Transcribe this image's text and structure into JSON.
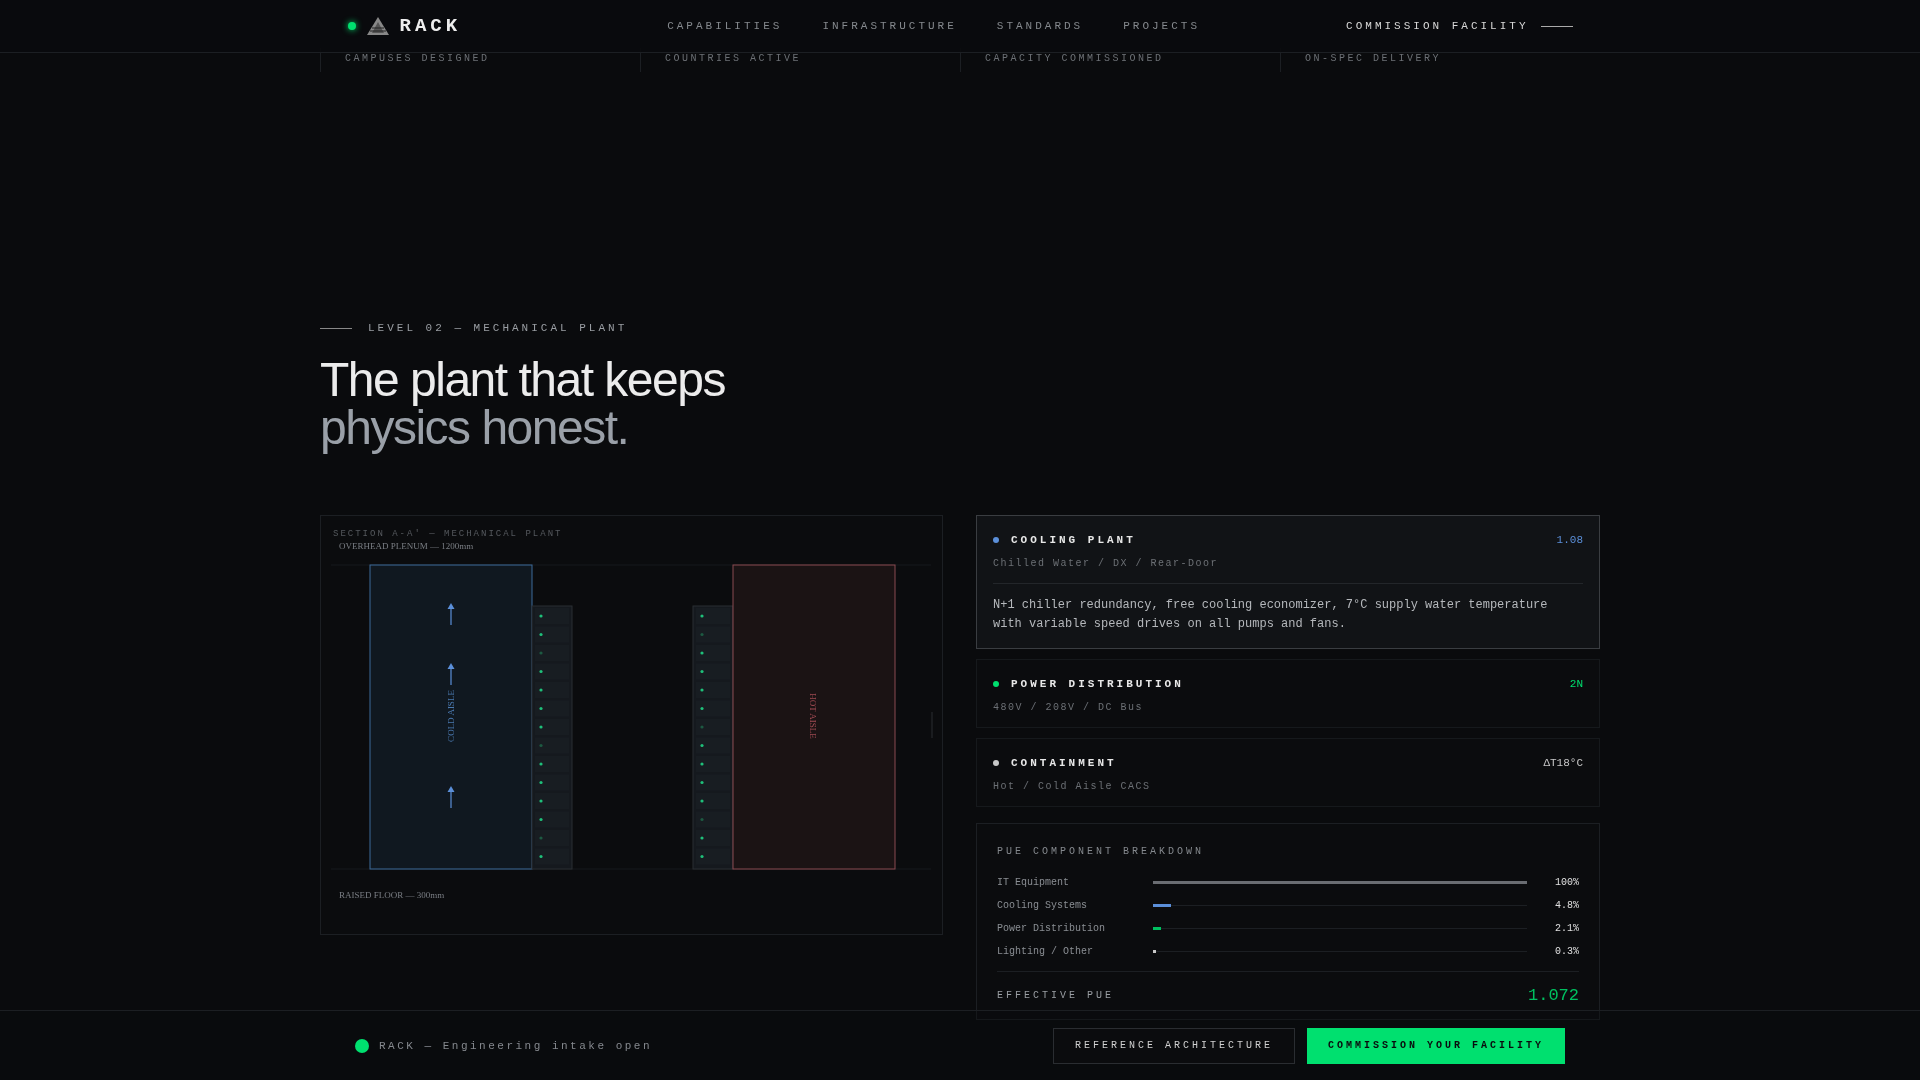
{
  "header": {
    "brand": "RACK",
    "nav": [
      {
        "label": "CAPABILITIES"
      },
      {
        "label": "INFRASTRUCTURE"
      },
      {
        "label": "STANDARDS"
      },
      {
        "label": "PROJECTS"
      }
    ],
    "cta": "COMMISSION FACILITY"
  },
  "stats": [
    {
      "label": "CAMPUSES DESIGNED"
    },
    {
      "label": "COUNTRIES ACTIVE"
    },
    {
      "label": "CAPACITY COMMISSIONED"
    },
    {
      "label": "ON-SPEC DELIVERY"
    }
  ],
  "section": {
    "eyebrow": "LEVEL 02 — MECHANICAL PLANT",
    "title": "The plant that keeps",
    "title_muted": "physics honest."
  },
  "diagram": {
    "title": "SECTION A-A′ — MECHANICAL PLANT",
    "top_label": "OVERHEAD PLENUM — 1200mm",
    "cold_label": "COLD AISLE",
    "hot_label": "HOT AISLE",
    "floor_label": "RAISED FLOOR — 300mm"
  },
  "systems": [
    {
      "name": "COOLING PLANT",
      "value": "1.08",
      "color": "#5b8fd9",
      "subtitle": "Chilled Water / DX / Rear-Door",
      "selected": true,
      "description": "N+1 chiller redundancy, free cooling economizer, 7°C supply water temperature with variable speed drives on all pumps and fans."
    },
    {
      "name": "POWER DISTRIBUTION",
      "value": "2N",
      "color": "#00e06f",
      "subtitle": "480V / 208V / DC Bus",
      "selected": false
    },
    {
      "name": "CONTAINMENT",
      "value": "ΔT18°C",
      "color": "#c8c8c8",
      "subtitle": "Hot / Cold Aisle CACS",
      "selected": false
    }
  ],
  "pue": {
    "title": "PUE COMPONENT BREAKDOWN",
    "rows": [
      {
        "label": "IT Equipment",
        "level": 1,
        "reading": "100%",
        "color": "#6a6d72"
      },
      {
        "label": "Cooling Systems",
        "level": 0.048,
        "reading": "4.8%",
        "color": "#5b8fd9"
      },
      {
        "label": "Power Distribution",
        "level": 0.021,
        "reading": "2.1%",
        "color": "#00c060"
      },
      {
        "label": "Lighting / Other",
        "level": 0.003,
        "reading": "0.3%",
        "color": "#c8c8c8"
      }
    ],
    "total_label": "EFFECTIVE PUE",
    "total_value": "1.072"
  },
  "footer": {
    "status": "RACK — Engineering intake open",
    "buttons": [
      {
        "label": "REFERENCE ARCHITECTURE",
        "kind": "secondary"
      },
      {
        "label": "COMMISSION YOUR FACILITY",
        "kind": "primary"
      }
    ]
  }
}
